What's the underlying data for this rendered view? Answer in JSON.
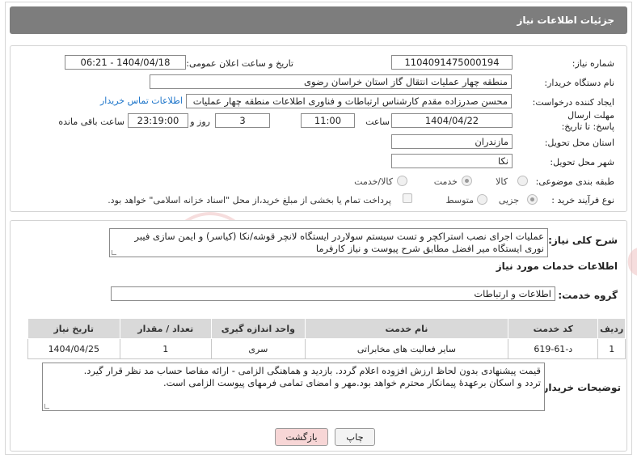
{
  "header": {
    "title": "جزئیات اطلاعات نیاز"
  },
  "fields": {
    "need_number_label": "شماره نیاز:",
    "need_number": "1104091475000194",
    "announce_label": "تاریخ و ساعت اعلان عمومی:",
    "announce_value": "1404/04/18 - 06:21",
    "buyer_org_label": "نام دستگاه خریدار:",
    "buyer_org": "منطقه چهار عملیات انتقال گاز    استان خراسان رضوی",
    "creator_label": "ایجاد کننده درخواست:",
    "creator": "محسن صدرزاده مقدم کارشناس ارتباطات و فناوری اطلاعات منطقه چهار عملیات",
    "contact_link": "اطلاعات تماس خریدار",
    "deadline_label": "مهلت ارسال پاسخ: تا تاریخ:",
    "deadline_date": "1404/04/22",
    "time_label": "ساعت",
    "deadline_time": "11:00",
    "days_value": "3",
    "days_label": "روز و",
    "remaining_time": "23:19:00",
    "remaining_label": "ساعت باقی مانده",
    "province_label": "استان محل تحویل:",
    "province": "مازندران",
    "city_label": "شهر محل تحویل:",
    "city": "نکا",
    "category_label": "طبقه بندی موضوعی:",
    "category_options": [
      "کالا",
      "خدمت",
      "کالا/خدمت"
    ],
    "category_selected": "خدمت",
    "process_label": "نوع فرآیند خرید :",
    "process_options": [
      "جزیی",
      "متوسط"
    ],
    "process_selected": "جزیی",
    "payment_note": "پرداخت تمام یا بخشی از مبلغ خرید،از محل \"اسناد خزانه اسلامی\" خواهد بود."
  },
  "description": {
    "label": "شرح کلی نیاز:",
    "text": "عملیات اجرای نصب استراکچر و تست سیستم سولاردر ایستگاه لانچر قوشه/نکا (کیاسر) و ایمن سازی فیبر نوری ایستگاه میر افضل مطابق شرح پیوست و نیاز کارفرما"
  },
  "services": {
    "section_title": "اطلاعات خدمات مورد نیاز",
    "group_label": "گروه خدمت:",
    "group_value": "اطلاعات و ارتباطات",
    "columns": [
      "ردیف",
      "کد خدمت",
      "نام خدمت",
      "واحد اندازه گیری",
      "تعداد / مقدار",
      "تاریخ نیاز"
    ],
    "rows": [
      [
        "1",
        "د-61-619",
        "سایر فعالیت های مخابراتی",
        "سری",
        "1",
        "1404/04/25"
      ]
    ]
  },
  "buyer_notes": {
    "label": "توضیحات خریدار:",
    "line1": "قیمت پیشنهادی بدون لحاظ ارزش افزوده اعلام گردد. بازدید و هماهنگی الزامی - ارائه مفاصا حساب مد نظر قرار گیرد.",
    "line2": "تردد و اسکان برعهدۀ پیمانکار محترم خواهد بود.مهر و امضای تمامی فرمهای پیوست الزامی است."
  },
  "buttons": {
    "print": "چاپ",
    "back": "بازگشت"
  },
  "colors": {
    "header_bg": "#7d7d7d",
    "link": "#1a73c9",
    "back_bg": "#f7d6d6",
    "watermark": "#e8b0b0"
  }
}
